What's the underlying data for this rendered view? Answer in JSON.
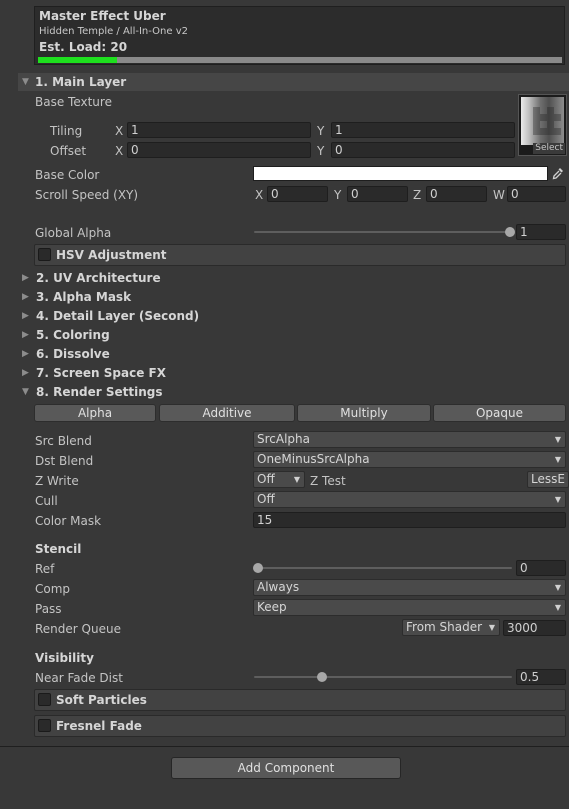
{
  "header": {
    "title": "Master Effect Uber",
    "subtitle": "Hidden Temple / All-In-One v2",
    "load_label": "Est. Load: 20",
    "load_fraction": 0.15
  },
  "main_layer": {
    "title": "1. Main Layer",
    "base_texture_label": "Base Texture",
    "tiling_label": "Tiling",
    "offset_label": "Offset",
    "x_label": "X",
    "y_label": "Y",
    "tiling_x": "1",
    "tiling_y": "1",
    "offset_x": "0",
    "offset_y": "0",
    "select_label": "Select",
    "base_color_label": "Base Color",
    "base_color": "#ffffff",
    "scroll_speed_label": "Scroll Speed (XY)",
    "scroll": [
      {
        "axis": "X",
        "value": "0"
      },
      {
        "axis": "Y",
        "value": "0"
      },
      {
        "axis": "Z",
        "value": "0"
      },
      {
        "axis": "W",
        "value": "0"
      }
    ],
    "global_alpha_label": "Global Alpha",
    "global_alpha_value": "1",
    "global_alpha_fraction": 1.0,
    "hsv_label": "HSV Adjustment"
  },
  "sections": [
    {
      "title": "2. UV Architecture"
    },
    {
      "title": "3. Alpha Mask"
    },
    {
      "title": "4. Detail Layer (Second)"
    },
    {
      "title": "5. Coloring"
    },
    {
      "title": "6. Dissolve"
    },
    {
      "title": "7. Screen Space FX"
    }
  ],
  "render_settings": {
    "title": "8. Render Settings",
    "blend_buttons": [
      "Alpha",
      "Additive",
      "Multiply",
      "Opaque"
    ],
    "src_blend_label": "Src Blend",
    "src_blend_value": "SrcAlpha",
    "dst_blend_label": "Dst Blend",
    "dst_blend_value": "OneMinusSrcAlpha",
    "zwrite_label": "Z Write",
    "zwrite_value": "Off",
    "ztest_label": "Z Test",
    "ztest_value": "LessE",
    "cull_label": "Cull",
    "cull_value": "Off",
    "color_mask_label": "Color Mask",
    "color_mask_value": "15",
    "stencil_heading": "Stencil",
    "ref_label": "Ref",
    "ref_value": "0",
    "ref_fraction": 0.0,
    "comp_label": "Comp",
    "comp_value": "Always",
    "pass_label": "Pass",
    "pass_value": "Keep",
    "render_queue_label": "Render Queue",
    "render_queue_mode": "From Shader",
    "render_queue_value": "3000",
    "visibility_heading": "Visibility",
    "near_fade_label": "Near Fade Dist",
    "near_fade_value": "0.5",
    "near_fade_fraction": 0.25,
    "soft_particles_label": "Soft Particles",
    "fresnel_fade_label": "Fresnel Fade"
  },
  "footer": {
    "add_component_label": "Add Component"
  },
  "colors": {
    "background": "#383838",
    "load_bar_fill": "#1ee01e",
    "load_bar_track": "#8a8a8a"
  }
}
